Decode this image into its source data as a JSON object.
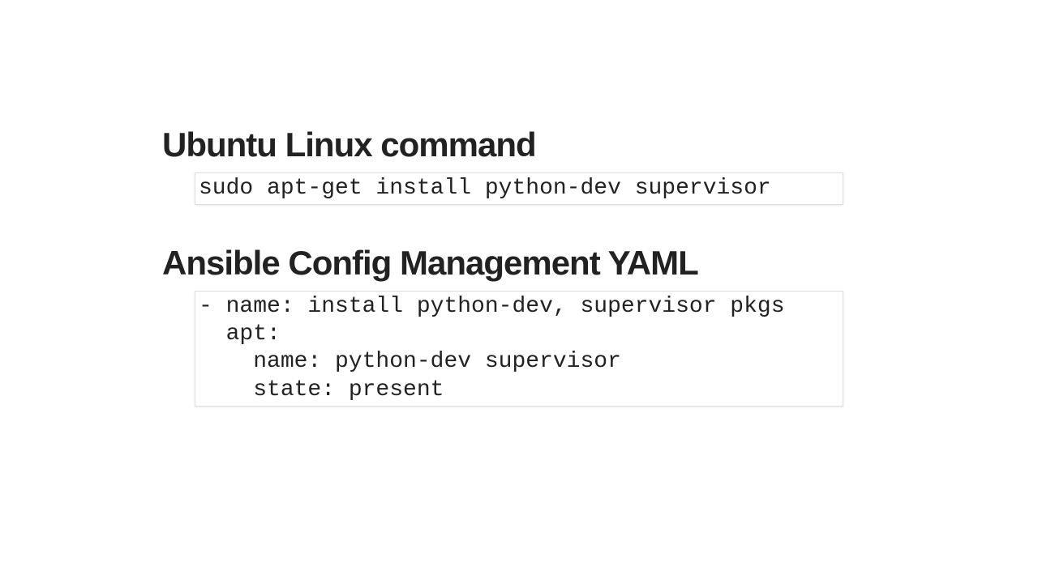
{
  "sections": [
    {
      "heading": "Ubuntu Linux command",
      "code": "sudo apt-get install python-dev supervisor"
    },
    {
      "heading": "Ansible Config Management YAML",
      "code": "- name: install python-dev, supervisor pkgs\n  apt:\n    name: python-dev supervisor\n    state: present"
    }
  ]
}
